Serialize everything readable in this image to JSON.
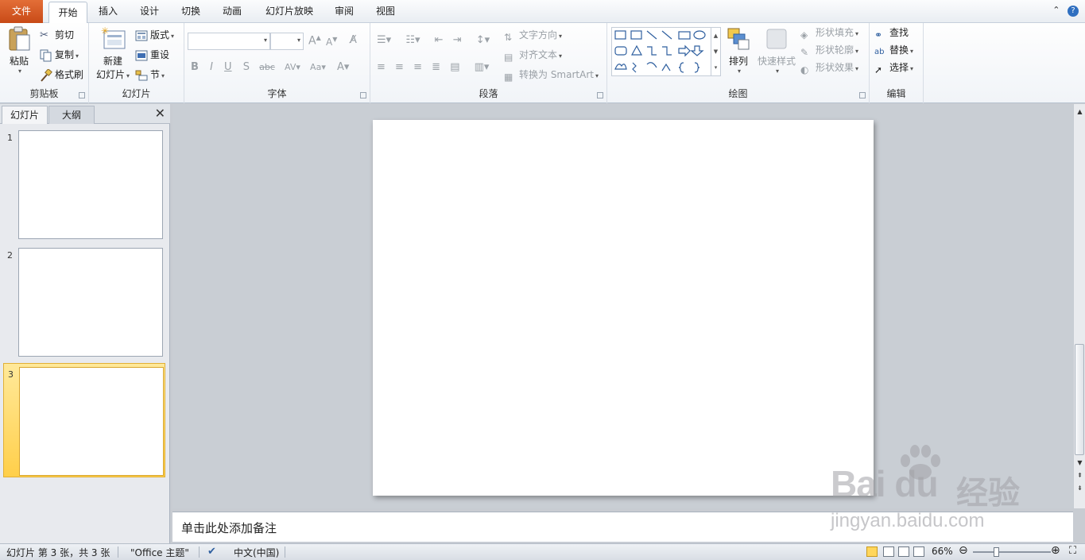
{
  "tabs": {
    "file": "文件",
    "home": "开始",
    "insert": "插入",
    "design": "设计",
    "transitions": "切换",
    "animations": "动画",
    "slideshow": "幻灯片放映",
    "review": "审阅",
    "view": "视图"
  },
  "clipboard": {
    "paste": "粘贴",
    "cut": "剪切",
    "copy": "复制",
    "format_painter": "格式刷",
    "label": "剪贴板"
  },
  "slides_group": {
    "new_slide_line1": "新建",
    "new_slide_line2": "幻灯片",
    "layout": "版式",
    "reset": "重设",
    "section": "节",
    "label": "幻灯片"
  },
  "font_group": {
    "label": "字体"
  },
  "paragraph_group": {
    "text_direction": "文字方向",
    "align_text": "对齐文本",
    "convert_smartart": "转换为 SmartArt",
    "label": "段落"
  },
  "drawing_group": {
    "arrange": "排列",
    "quick_styles": "快速样式",
    "shape_fill": "形状填充",
    "shape_outline": "形状轮廓",
    "shape_effects": "形状效果",
    "label": "绘图"
  },
  "editing_group": {
    "find": "查找",
    "replace": "替换",
    "select": "选择",
    "label": "编辑"
  },
  "panel": {
    "tab_slides": "幻灯片",
    "tab_outline": "大纲",
    "thumbnails": [
      {
        "num": "1"
      },
      {
        "num": "2"
      },
      {
        "num": "3"
      }
    ]
  },
  "notes_placeholder": "单击此处添加备注",
  "status": {
    "slide_info": "幻灯片 第 3 张，共 3 张",
    "theme": "\"Office 主题\"",
    "language": "中文(中国)",
    "zoom": "66%"
  },
  "watermark": {
    "brand": "Bai du",
    "jingyan": "经验",
    "url": "jingyan.baidu.com"
  },
  "colors": {
    "file_tab": "#d4571f",
    "selected_thumb": "#ffd65c"
  }
}
